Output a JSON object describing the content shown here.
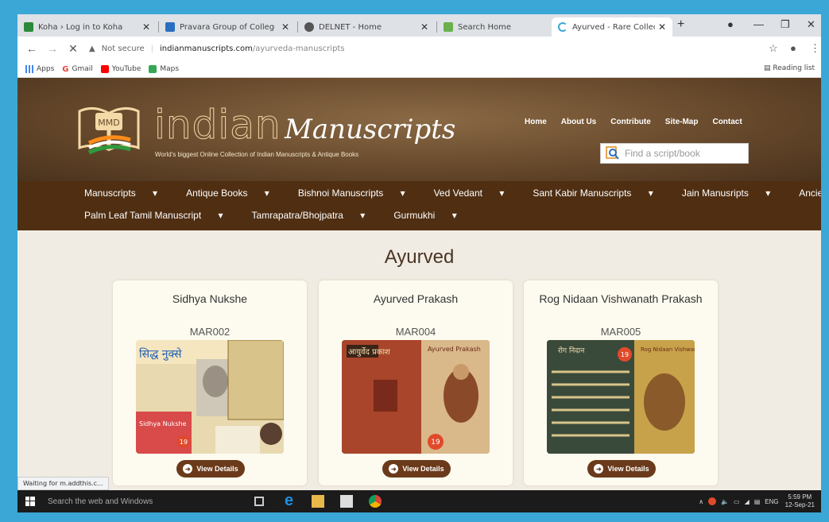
{
  "browser": {
    "tabs": [
      {
        "label": "Koha › Log in to Koha",
        "icon_color": "#2a8a3a"
      },
      {
        "label": "Pravara Group of Colleges ca",
        "icon_color": "#2a6fbf"
      },
      {
        "label": "DELNET - Home",
        "icon_color": "#555555"
      },
      {
        "label": "Search Home",
        "icon_color": "#6ab04c"
      },
      {
        "label": "Ayurved - Rare Collection of",
        "icon_color": "#3aa7d6"
      }
    ],
    "new_tab": "+",
    "address": {
      "security": "Not secure",
      "domain": "indianmanuscripts.com",
      "path": "/ayurveda-manuscripts"
    },
    "bookmarks": [
      {
        "label": "Apps",
        "icon": "apps-grid-icon",
        "color": "#4285f4"
      },
      {
        "label": "Gmail",
        "icon": "google-icon",
        "color": "#ea4335"
      },
      {
        "label": "YouTube",
        "icon": "youtube-icon",
        "color": "#ff0000"
      },
      {
        "label": "Maps",
        "icon": "maps-icon",
        "color": "#34a853"
      }
    ],
    "reading_list": "Reading list",
    "status": "Waiting for m.addthis.c..."
  },
  "site": {
    "brand_word1": "indian",
    "brand_word2": "Manuscripts",
    "tagline": "World's biggest Online Collection of Indian Manuscripts & Antique Books",
    "top_nav": [
      "Home",
      "About Us",
      "Contribute",
      "Site-Map",
      "Contact"
    ],
    "search_placeholder": "Find a script/book",
    "menu_row1": [
      "Manuscripts",
      "Antique Books",
      "Bishnoi Manuscripts",
      "Ved Vedant",
      "Sant Kabir Manuscripts",
      "Jain Manusripts",
      "Ancient Documents"
    ],
    "menu_row2": [
      "Palm Leaf Tamil Manuscript",
      "Tamrapatra/Bhojpatra",
      "Gurmukhi"
    ],
    "caret": "▾"
  },
  "page": {
    "title": "Ayurved",
    "cards": [
      {
        "title": "Sidhya Nukshe",
        "code": "MAR002",
        "button": "View Details",
        "cover_text": "सिद्ध नुक्से",
        "cover_caption": "Sidhya Nukshe",
        "badge": "19"
      },
      {
        "title": "Ayurved Prakash",
        "code": "MAR004",
        "button": "View Details",
        "cover_text": "आयुर्वेद प्रकाश",
        "cover_caption": "Ayurved Prakash",
        "badge": "19"
      },
      {
        "title": "Rog Nidaan Vishwanath Prakash",
        "code": "MAR005",
        "button": "View Details",
        "cover_text": "रोग निदान",
        "cover_caption": "Rog Nidaan Vishwanath Prakash",
        "badge": "19"
      }
    ]
  },
  "taskbar": {
    "search_text": "Search the web and Windows",
    "lang": "ENG",
    "time": "5:59 PM",
    "date": "12-Sep-21"
  }
}
